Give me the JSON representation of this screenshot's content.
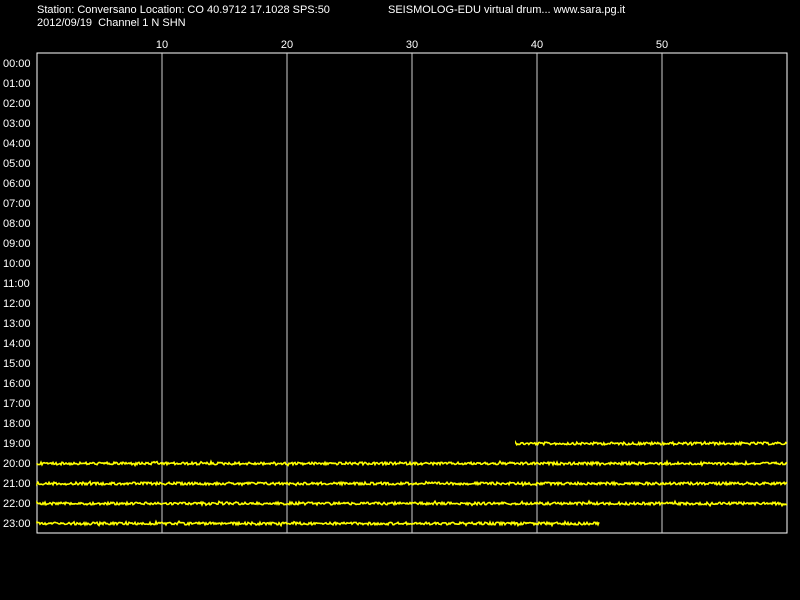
{
  "header": {
    "station_line": "Station: Conversano Location: CO 40.9712 17.1028 SPS:50",
    "title": "SEISMOLOG-EDU virtual drum... www.sara.pg.it",
    "date_line": "2012/09/19  Channel 1 N SHN"
  },
  "chart_data": {
    "type": "line",
    "title": "SEISMOLOG-EDU virtual drum... www.sara.pg.it",
    "xlabel": "",
    "ylabel": "",
    "x_ticks": [
      10,
      20,
      30,
      40,
      50
    ],
    "xlim": [
      0,
      60
    ],
    "y_ticks": [
      "00:00",
      "01:00",
      "02:00",
      "03:00",
      "04:00",
      "05:00",
      "06:00",
      "07:00",
      "08:00",
      "09:00",
      "10:00",
      "11:00",
      "12:00",
      "13:00",
      "14:00",
      "15:00",
      "16:00",
      "17:00",
      "18:00",
      "19:00",
      "20:00",
      "21:00",
      "22:00",
      "23:00"
    ],
    "grid": "vertical",
    "trace_color": "#ffff00",
    "series": [
      {
        "hour": "19:00",
        "x_start": 38.3,
        "x_end": 60
      },
      {
        "hour": "20:00",
        "x_start": 0,
        "x_end": 60
      },
      {
        "hour": "21:00",
        "x_start": 0,
        "x_end": 60
      },
      {
        "hour": "22:00",
        "x_start": 0,
        "x_end": 60
      },
      {
        "hour": "23:00",
        "x_start": 0,
        "x_end": 45
      }
    ]
  }
}
